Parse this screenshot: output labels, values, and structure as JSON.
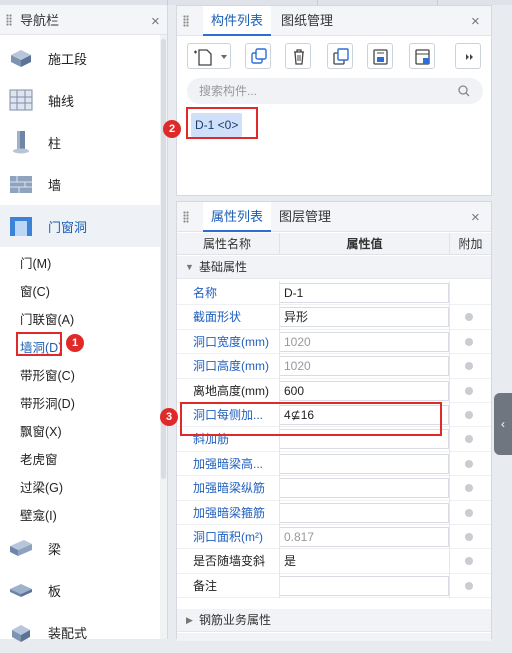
{
  "nav": {
    "title": "导航栏",
    "categories": [
      {
        "label": "施工段",
        "icon": "construction-stage-icon"
      },
      {
        "label": "轴线",
        "icon": "axis-grid-icon"
      },
      {
        "label": "柱",
        "icon": "column-icon"
      },
      {
        "label": "墙",
        "icon": "wall-icon"
      },
      {
        "label": "门窗洞",
        "icon": "door-window-icon"
      },
      {
        "label": "梁",
        "icon": "beam-icon"
      },
      {
        "label": "板",
        "icon": "slab-icon"
      },
      {
        "label": "装配式",
        "icon": "prefab-icon"
      }
    ],
    "sub_items": [
      "门(M)",
      "窗(C)",
      "门联窗(A)",
      "墙洞(D)",
      "带形窗(C)",
      "带形洞(D)",
      "飘窗(X)",
      "老虎窗",
      "过梁(G)",
      "壁龛(I)"
    ],
    "selected_sub": "墙洞(D)"
  },
  "component_panel": {
    "tabs": [
      "构件列表",
      "图纸管理"
    ],
    "toolbar_icons": [
      "new-component-icon",
      "dropdown-arrow-icon",
      "copy-icon",
      "delete-icon",
      "copy-to-floor-icon",
      "floor-copy-icon",
      "column-settings-icon",
      "more-icon"
    ],
    "search_placeholder": "搜索构件...",
    "selected_component": "D-1 <0>"
  },
  "property_panel": {
    "tabs": [
      "属性列表",
      "图层管理"
    ],
    "headers": {
      "name": "属性名称",
      "value": "属性值",
      "extra": "附加"
    },
    "section_basic": "基础属性",
    "rows": [
      {
        "name": "名称",
        "value": "D-1"
      },
      {
        "name": "截面形状",
        "value": "异形"
      },
      {
        "name": "洞口宽度(mm)",
        "value": "1020"
      },
      {
        "name": "洞口高度(mm)",
        "value": "1020"
      },
      {
        "name": "离地高度(mm)",
        "value": "600"
      },
      {
        "name": "洞口每侧加...",
        "value": "4⊈16"
      },
      {
        "name": "斜加筋",
        "value": ""
      },
      {
        "name": "加强暗梁高...",
        "value": ""
      },
      {
        "name": "加强暗梁纵筋",
        "value": ""
      },
      {
        "name": "加强暗梁箍筋",
        "value": ""
      },
      {
        "name": "洞口面积(m²)",
        "value": "0.817"
      },
      {
        "name": "是否随墙变斜",
        "value": "是"
      },
      {
        "name": "备注",
        "value": ""
      }
    ],
    "section_rebar": "钢筋业务属性"
  },
  "annotations": [
    "1",
    "2",
    "3"
  ],
  "colors": {
    "accent": "#1a5fb4",
    "marker": "#e02a2a",
    "selection": "#cfe0f8"
  }
}
